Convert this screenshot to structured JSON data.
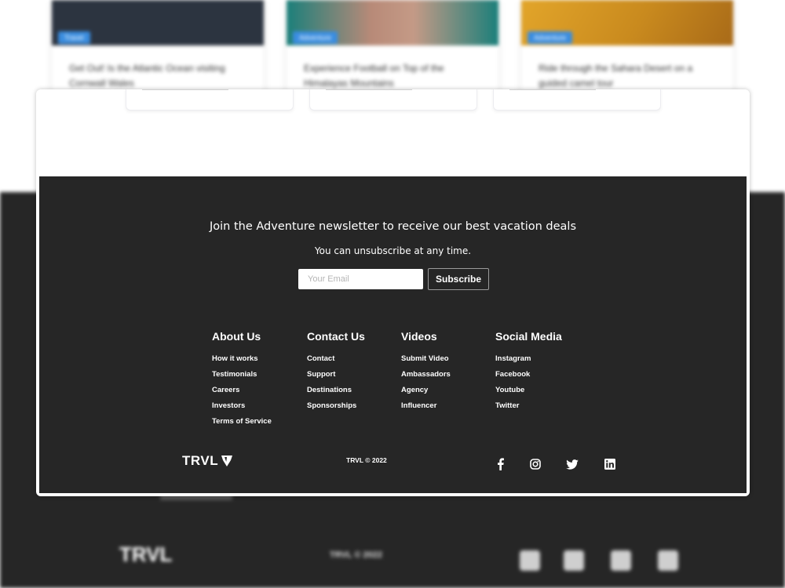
{
  "background": {
    "cards": [
      {
        "tag": "Travel",
        "title": "Get Out! Is the Atlantic Ocean visiting Cornwall Wales"
      },
      {
        "tag": "Adventure",
        "title": "Experience Football on Top of the Himalayas Mountains"
      },
      {
        "tag": "Adventure",
        "title": "Ride through the Sahara Desert on a guided camel tour"
      }
    ],
    "logo": "TRVL",
    "copyright": "TRVL © 2022"
  },
  "newsletter": {
    "heading": "Join the Adventure newsletter to receive our best vacation deals",
    "subheading": "You can unsubscribe at any time.",
    "email_placeholder": "Your Email",
    "subscribe_label": "Subscribe"
  },
  "footer_columns": [
    {
      "title": "About Us",
      "links": [
        "How it works",
        "Testimonials",
        "Careers",
        "Investors",
        "Terms of Service"
      ]
    },
    {
      "title": "Contact Us",
      "links": [
        "Contact",
        "Support",
        "Destinations",
        "Sponsorships"
      ]
    },
    {
      "title": "Videos",
      "links": [
        "Submit Video",
        "Ambassadors",
        "Agency",
        "Influencer"
      ]
    },
    {
      "title": "Social Media",
      "links": [
        "Instagram",
        "Facebook",
        "Youtube",
        "Twitter"
      ]
    }
  ],
  "bottom": {
    "logo_text": "TRVL",
    "copyright": "TRVL © 2022",
    "social_icons": [
      "facebook-icon",
      "instagram-icon",
      "twitter-icon",
      "linkedin-icon"
    ]
  },
  "colors": {
    "footer_bg": "#262626",
    "tag_blue": "#3a8de0",
    "white": "#ffffff"
  }
}
